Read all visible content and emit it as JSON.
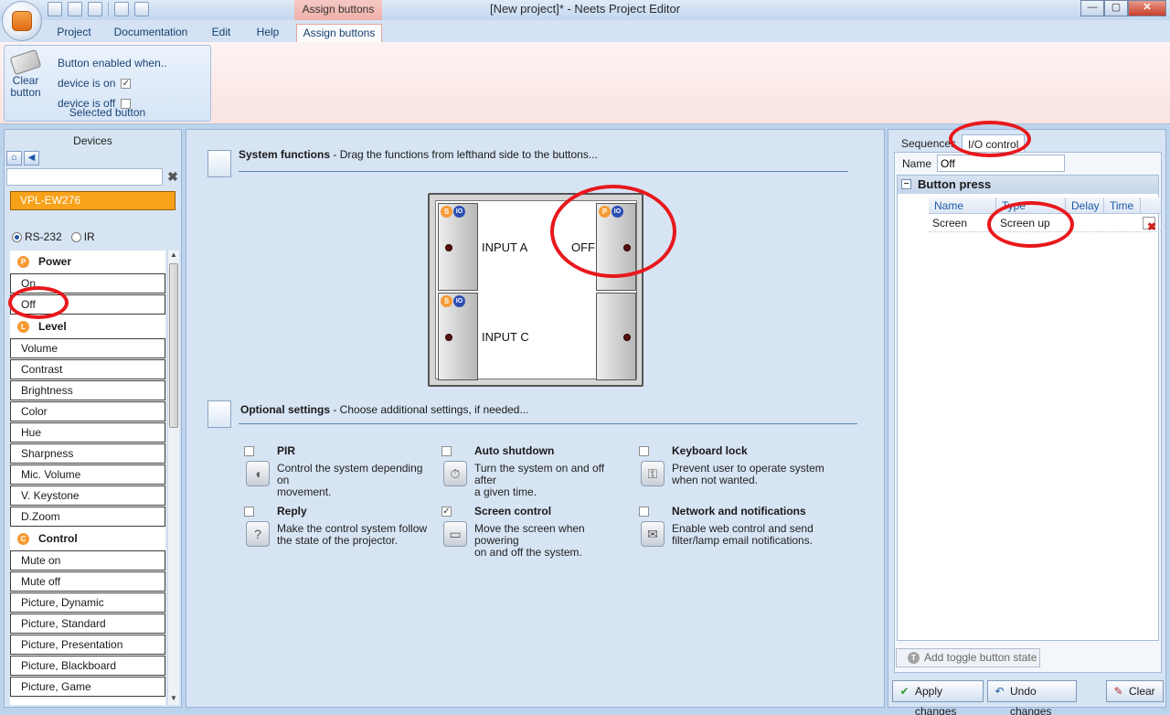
{
  "window": {
    "title": "[New project]* - Neets Project Editor",
    "context_tab_title": "Assign buttons",
    "minimize": "—",
    "maximize": "▢",
    "close": "✕"
  },
  "ribbon_tabs": [
    "Project",
    "Documentation",
    "Edit",
    "Help",
    "Assign buttons"
  ],
  "selected_button_group": {
    "clear_label": "Clear button",
    "enabled_when": "Button enabled when..",
    "device_on": "device is on",
    "device_off": "device is off",
    "device_on_checked": "✓",
    "group_label": "Selected button"
  },
  "devices": {
    "title": "Devices",
    "search_value": "",
    "clear_search": "✖",
    "selected_device": "VPL-EW276",
    "protocols": [
      "RS-232",
      "IR"
    ],
    "categories": [
      {
        "name": "Power",
        "badge": "P",
        "items": [
          "On",
          "Off"
        ]
      },
      {
        "name": "Level",
        "badge": "L",
        "items": [
          "Volume",
          "Contrast",
          "Brightness",
          "Color",
          "Hue",
          "Sharpness",
          "Mic. Volume",
          "V. Keystone",
          "D.Zoom"
        ]
      },
      {
        "name": "Control",
        "badge": "C",
        "items": [
          "Mute on",
          "Mute off",
          "Picture, Dynamic",
          "Picture, Standard",
          "Picture, Presentation",
          "Picture, Blackboard",
          "Picture, Game"
        ]
      }
    ]
  },
  "system_functions": {
    "title": "System functions",
    "subtitle": " - Drag the functions from lefthand side to the buttons...",
    "keypad": {
      "btn_top_left": "INPUT A",
      "btn_top_right": "OFF",
      "btn_bottom_left": "INPUT C",
      "badge_s": "S",
      "badge_p": "P",
      "badge_io": "IO"
    }
  },
  "optional_settings": {
    "title": "Optional settings",
    "subtitle": " - Choose additional settings, if needed...",
    "options": [
      {
        "title": "PIR",
        "desc1": "Control the system depending on",
        "desc2": "movement.",
        "checked": ""
      },
      {
        "title": "Auto shutdown",
        "desc1": "Turn the system on and off after",
        "desc2": "a given time.",
        "checked": ""
      },
      {
        "title": "Keyboard lock",
        "desc1": "Prevent user to operate system",
        "desc2": "when not wanted.",
        "checked": ""
      },
      {
        "title": "Reply",
        "desc1": "Make the control system follow",
        "desc2": "the state of the projector.",
        "checked": ""
      },
      {
        "title": "Screen control",
        "desc1": "Move the screen when powering",
        "desc2": "on and off the system.",
        "checked": "✓"
      },
      {
        "title": "Network and notifications",
        "desc1": "Enable web control and send",
        "desc2": "filter/lamp email notifications.",
        "checked": ""
      }
    ]
  },
  "right_panel": {
    "tabs": [
      "Sequences",
      "I/O control"
    ],
    "name_label": "Name",
    "name_value": "Off",
    "section": "Button press",
    "expander": "−",
    "columns": [
      "Name",
      "Type",
      "Delay",
      "Time"
    ],
    "rows": [
      {
        "name": "Screen",
        "type": "Screen up",
        "delay": "",
        "time": ""
      }
    ],
    "delete_icon": "✖",
    "toggle_button": "Add toggle button state",
    "apply": "Apply changes",
    "undo": "Undo changes",
    "clear": "Clear"
  }
}
